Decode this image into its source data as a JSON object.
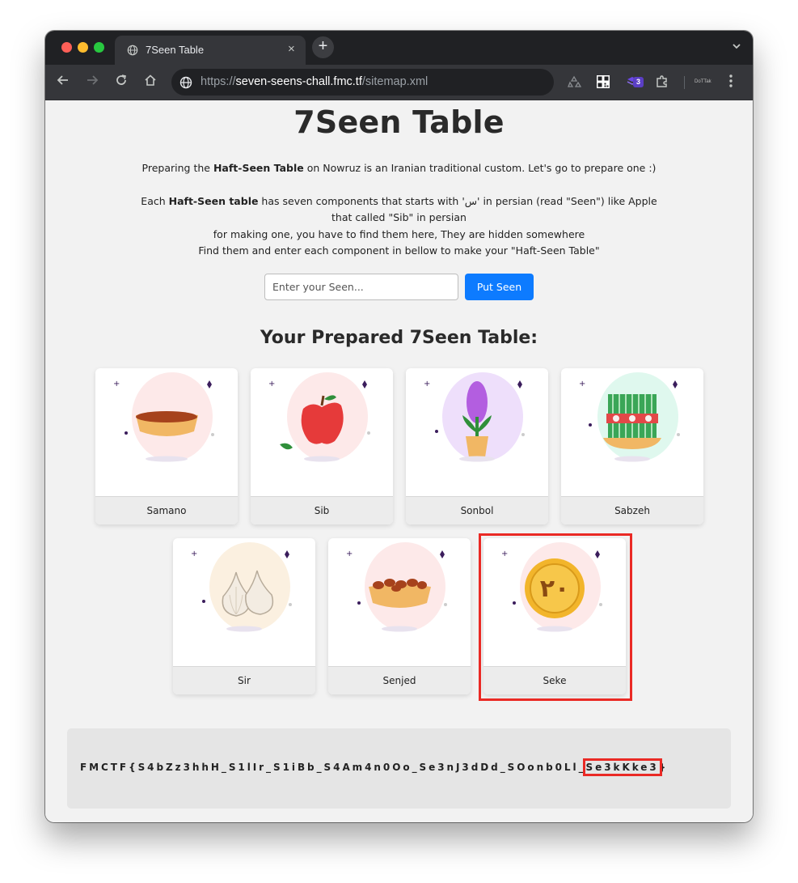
{
  "browser": {
    "tab_title": "7Seen Table",
    "tab_close": "×",
    "new_tab": "+",
    "url_scheme": "https://",
    "url_host": "seven-seens-chall.fmc.tf",
    "url_path": "/sitemap.xml",
    "extension_badge": "3",
    "profile_label": "DoTTak"
  },
  "page": {
    "title": "7Seen Table",
    "intro_line1_a": "Preparing the ",
    "intro_line1_bold": "Haft-Seen Table",
    "intro_line1_b": " on Nowruz is an Iranian traditional custom. Let's go to prepare one :)",
    "intro_line2_a": "Each ",
    "intro_line2_bold": "Haft-Seen table",
    "intro_line2_b": " has seven components that starts with 'س' in persian (read \"Seen\") like Apple",
    "intro_line3": "that called \"Sib\" in persian",
    "intro_line4": "for making one, you have to find them here, They are hidden somewhere",
    "intro_line5": "Find them and enter each component in bellow to make your \"Haft-Seen Table\"",
    "input_placeholder": "Enter your Seen...",
    "button_label": "Put Seen",
    "prepared_heading": "Your Prepared 7Seen Table:"
  },
  "seens": [
    {
      "name": "Samano",
      "icon": "samanu-bowl-icon",
      "glow": "#fde3e3"
    },
    {
      "name": "Sib",
      "icon": "apple-icon",
      "glow": "#fde3e3"
    },
    {
      "name": "Sonbol",
      "icon": "hyacinth-icon",
      "glow": "#ecdcfb"
    },
    {
      "name": "Sabzeh",
      "icon": "wheatgrass-icon",
      "glow": "#dcf7ec"
    },
    {
      "name": "Sir",
      "icon": "garlic-icon",
      "glow": "#fbeedd"
    },
    {
      "name": "Senjed",
      "icon": "senjed-bowl-icon",
      "glow": "#fde3e3"
    },
    {
      "name": "Seke",
      "icon": "coin-icon",
      "glow": "#fde3e3",
      "coin_text": "۲۰"
    }
  ],
  "flag": {
    "prefix": "FMCTF{S4bZz3hhH_S1lIr_S1iBb_S4Am4n0Oo_Se3nJ3dDd_SOonb0Ll_",
    "highlighted": "Se3kKke3",
    "suffix": "}"
  },
  "colors": {
    "accent_button": "#0d7bff",
    "highlight": "#ea2a25",
    "flag_bg": "#e5e5e5"
  }
}
